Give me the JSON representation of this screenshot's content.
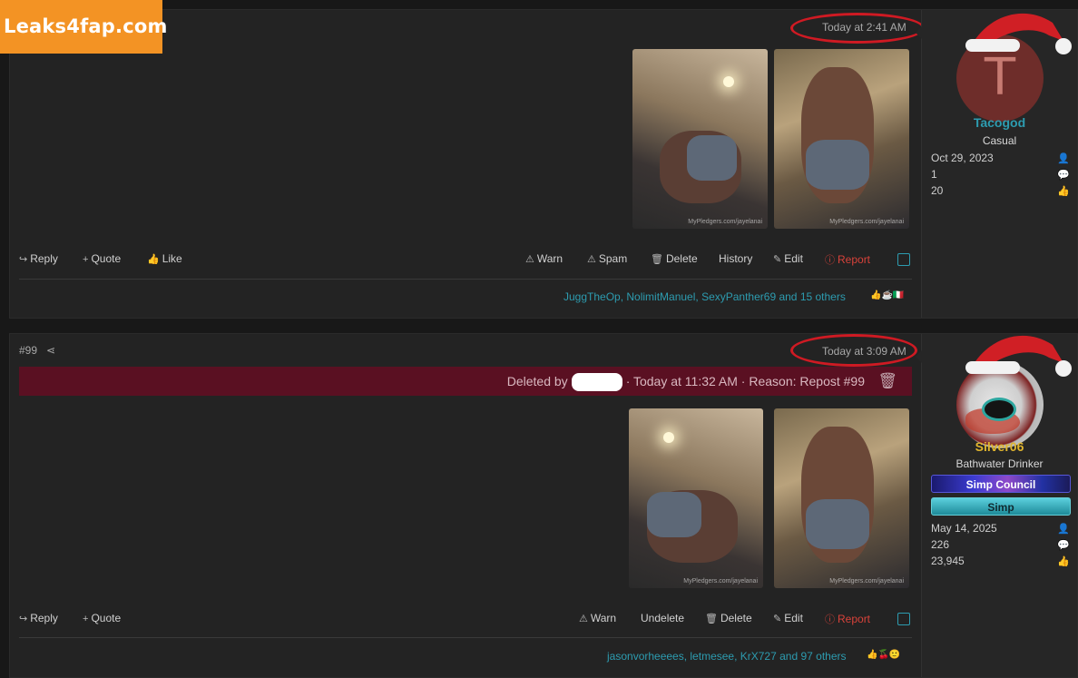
{
  "watermark": "Leaks4fap.com",
  "posts": [
    {
      "time": "Today at 2:41 AM",
      "user": {
        "avatar_letter": "T",
        "name": "Tacogod",
        "name_color": "#2d9cb0",
        "title": "Casual",
        "stats": [
          {
            "icon": "user-icon",
            "value": "Oct 29, 2023"
          },
          {
            "icon": "message-icon",
            "value": "1"
          },
          {
            "icon": "thumbs-up-icon",
            "value": "20"
          }
        ]
      },
      "image_captions": [
        "MyPledgers.com/jayelanai",
        "MyPledgers.com/jayelanai"
      ],
      "actions_left": [
        "Report",
        "Edit",
        "History",
        "Delete",
        "Spam",
        "Warn"
      ],
      "actions_right": [
        "Like",
        "Quote",
        "Reply"
      ],
      "likes_text": "JuggTheOp, NolimitManuel, SexyPanther69 and 15 others"
    },
    {
      "time": "Today at 3:09 AM",
      "post_number": "#99",
      "deleted_notice": "Deleted by",
      "deleted_detail": "· Today at 11:32 AM · Reason: Repost #99",
      "user": {
        "name": "Silver06",
        "name_color": "#e0b52e",
        "title": "Bathwater Drinker",
        "banners": [
          "Simp Council",
          "Simp"
        ],
        "stats": [
          {
            "icon": "user-icon",
            "value": "May 14, 2025"
          },
          {
            "icon": "message-icon",
            "value": "226"
          },
          {
            "icon": "thumbs-up-icon",
            "value": "23,945"
          }
        ]
      },
      "image_captions": [
        "MyPledgers.com/jayelanai",
        "MyPledgers.com/jayelanai"
      ],
      "actions_left": [
        "Report",
        "Edit",
        "Delete",
        "Undelete",
        "Warn"
      ],
      "actions_right": [
        "Quote",
        "Reply"
      ],
      "likes_text": "jasonvorheeees, letmesee, KrX727 and 97 others"
    }
  ],
  "colors": {
    "accent": "#2d9cb0",
    "report": "#d8423a",
    "deleted_bg": "#5a1022",
    "highlight_oval": "#cf1a23"
  }
}
